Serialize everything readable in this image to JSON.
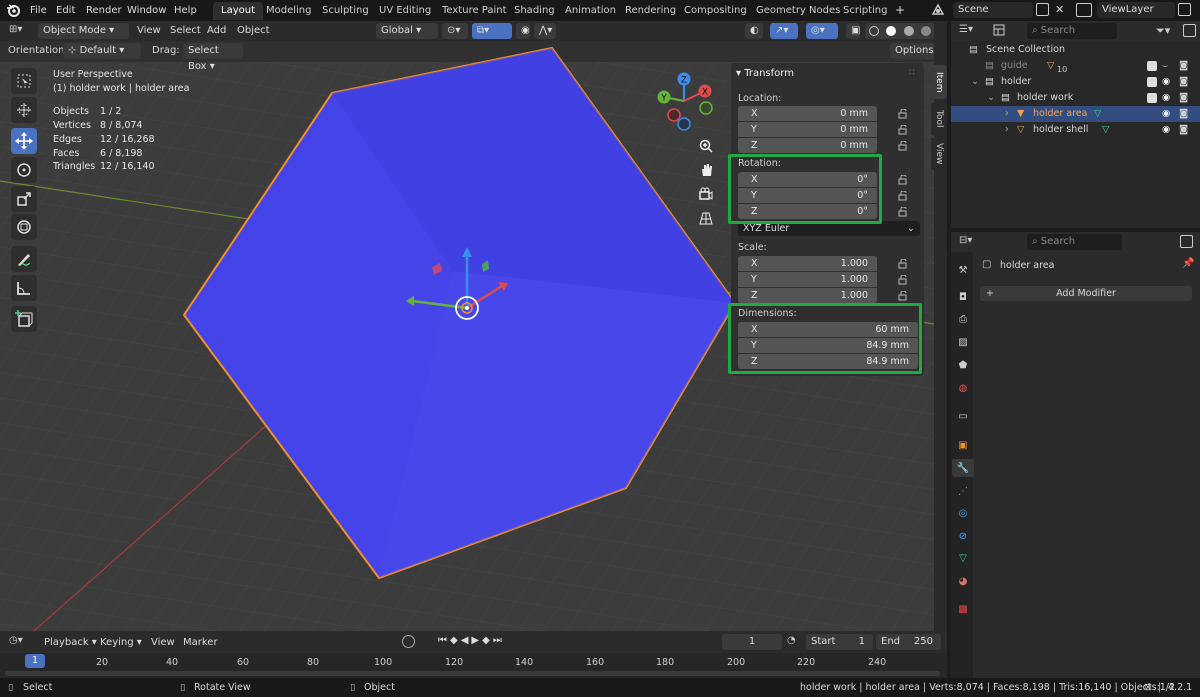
{
  "topbar": {
    "menus": [
      "File",
      "Edit",
      "Render",
      "Window",
      "Help"
    ],
    "workspaces": [
      "Layout",
      "Modeling",
      "Sculpting",
      "UV Editing",
      "Texture Paint",
      "Shading",
      "Animation",
      "Rendering",
      "Compositing",
      "Geometry Nodes",
      "Scripting"
    ],
    "add_tab": "+",
    "scene": "Scene",
    "view_layer": "ViewLayer"
  },
  "viewport_header": {
    "mode": "Object Mode",
    "menus": [
      "View",
      "Select",
      "Add",
      "Object"
    ],
    "transform_orientation": "Global",
    "orientation_label": "Orientation:",
    "orientation_value": "Default",
    "drag_label": "Drag:",
    "drag_value": "Select Box",
    "options": "Options"
  },
  "overlay_stats": {
    "view_name": "User Perspective",
    "context": "(1) holder work | holder area",
    "rows": [
      {
        "label": "Objects",
        "value": "1 / 2"
      },
      {
        "label": "Vertices",
        "value": "8 / 8,074"
      },
      {
        "label": "Edges",
        "value": "12 / 16,268"
      },
      {
        "label": "Faces",
        "value": "6 / 8,198"
      },
      {
        "label": "Triangles",
        "value": "12 / 16,140"
      }
    ]
  },
  "gizmo": {
    "x": "X",
    "y": "Y",
    "z": "Z"
  },
  "npanel": {
    "title": "Transform",
    "location_label": "Location:",
    "location": [
      {
        "axis": "X",
        "value": "0 mm"
      },
      {
        "axis": "Y",
        "value": "0 mm"
      },
      {
        "axis": "Z",
        "value": "0 mm"
      }
    ],
    "rotation_label": "Rotation:",
    "rotation": [
      {
        "axis": "X",
        "value": "0°"
      },
      {
        "axis": "Y",
        "value": "0°"
      },
      {
        "axis": "Z",
        "value": "0°"
      }
    ],
    "rotation_mode": "XYZ Euler",
    "scale_label": "Scale:",
    "scale": [
      {
        "axis": "X",
        "value": "1.000"
      },
      {
        "axis": "Y",
        "value": "1.000"
      },
      {
        "axis": "Z",
        "value": "1.000"
      }
    ],
    "dimensions_label": "Dimensions:",
    "dimensions": [
      {
        "axis": "X",
        "value": "60 mm"
      },
      {
        "axis": "Y",
        "value": "84.9 mm"
      },
      {
        "axis": "Z",
        "value": "84.9 mm"
      }
    ],
    "tabs": [
      "Item",
      "Tool",
      "View"
    ]
  },
  "outliner": {
    "search_placeholder": "Search",
    "rows": [
      {
        "name": "Scene Collection"
      },
      {
        "name": "guide",
        "badge": "10"
      },
      {
        "name": "holder"
      },
      {
        "name": "holder work"
      },
      {
        "name": "holder area"
      },
      {
        "name": "holder shell"
      }
    ]
  },
  "properties": {
    "search_placeholder": "Search",
    "object_name": "holder area",
    "add_modifier": "Add Modifier"
  },
  "timeline": {
    "menus": [
      "Playback",
      "Keying",
      "View",
      "Marker"
    ],
    "current_frame": "1",
    "start_label": "Start",
    "start_value": "1",
    "end_label": "End",
    "end_value": "250",
    "playhead": "1",
    "ticks": [
      "20",
      "40",
      "60",
      "80",
      "100",
      "120",
      "140",
      "160",
      "180",
      "200",
      "220",
      "240"
    ]
  },
  "statusbar": {
    "select": "Select",
    "rotate": "Rotate View",
    "object": "Object",
    "info": "holder work | holder area | Verts:8,074 | Faces:8,198 | Tris:16,140 | Objects:1/2",
    "version": "4.2.1"
  },
  "colors": {
    "cube": "#4242e6",
    "selection": "#f0902a",
    "highlight": "#22a844",
    "accent": "#4a72c1"
  }
}
